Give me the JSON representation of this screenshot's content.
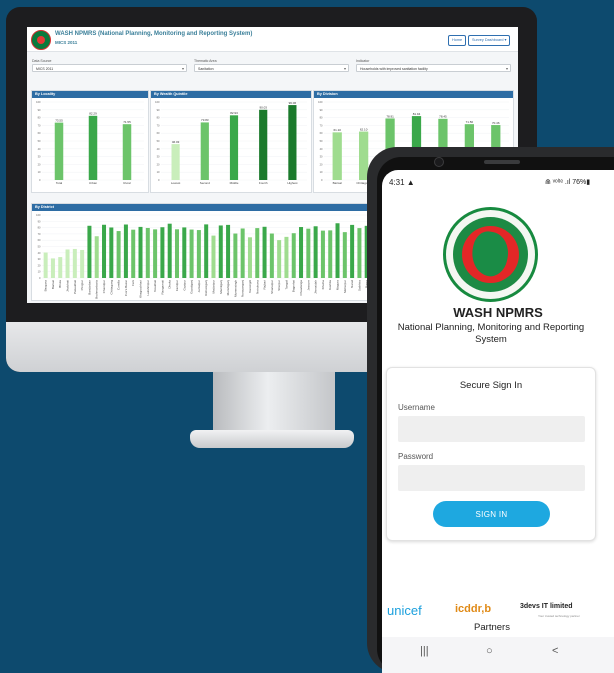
{
  "dashboard": {
    "title": "WASH NPMRS (National Planning, Monitoring and Reporting System)",
    "subtitle": "MICS 2011",
    "buttons": {
      "home": "Home",
      "survey": "Survey Dashboard ▾"
    },
    "filters": [
      {
        "label": "Data Source",
        "value": "MICS 2011"
      },
      {
        "label": "Thematic Area",
        "value": "Sanitation"
      },
      {
        "label": "Indicator",
        "value": "Households with improved sanitation facility"
      }
    ],
    "panels": {
      "locality": "By Locality",
      "wealth": "By Wealth Quintile",
      "division": "By Division",
      "district": "By District"
    }
  },
  "chart_data": [
    {
      "type": "bar",
      "title": "By Locality",
      "categories": [
        "Total",
        "Urban",
        "Rural"
      ],
      "values": [
        73.55,
        82.29,
        71.55
      ],
      "ylim": [
        0,
        100
      ]
    },
    {
      "type": "bar",
      "title": "By Wealth Quintile",
      "categories": [
        "Lowest",
        "Second",
        "Middle",
        "Fourth",
        "Highest"
      ],
      "values": [
        46.03,
        73.83,
        82.93,
        90.03,
        96.06
      ],
      "ylim": [
        0,
        100
      ]
    },
    {
      "type": "bar",
      "title": "By Division",
      "categories": [
        "Barisal",
        "Chittagong",
        "Dhaka",
        "Khulna",
        "Rajshahi",
        "Rangpur",
        "Sylhet"
      ],
      "values": [
        61.1,
        62.1,
        78.91,
        81.94,
        78.45,
        71.56,
        70.46
      ],
      "ylim": [
        0,
        100
      ]
    },
    {
      "type": "bar",
      "title": "By District",
      "categories": [
        "Barguna",
        "Barisal",
        "Bhola",
        "Jhalokati",
        "Patuakhali",
        "Pirojpur",
        "Bandarban",
        "Brahmanbaria",
        "Chandpur",
        "Chittagong",
        "Comilla",
        "Cox's Bazar",
        "Feni",
        "Khagrachhari",
        "Lakshmipur",
        "Noakhali",
        "Rangamati",
        "Dhaka",
        "Faridpur",
        "Gazipur",
        "Gopalganj",
        "Jamalpur",
        "Kishoreganj",
        "Madaripur",
        "Manikganj",
        "Munshiganj",
        "Mymensingh",
        "Narayanganj",
        "Narsingdi",
        "Netrokona",
        "Rajbari",
        "Shariatpur",
        "Sherpur",
        "Tangail",
        "Bagerhat",
        "Chuadanga",
        "Jessore",
        "Jhenaidah",
        "Khulna",
        "Kushtia",
        "Magura",
        "Meherpur",
        "Narail",
        "Satkhira",
        "Bogra",
        "Joypurhat",
        "Naogaon",
        "Natore",
        "Nawabganj",
        "Pabna",
        "Rajshahi",
        "Sirajganj",
        "Dinajpur",
        "Gaibandha",
        "Kurigram",
        "Lalmonirhat",
        "Nilphamari",
        "Panchagarh",
        "Rangpur",
        "Thakurgaon",
        "Habiganj",
        "Moulvibazar",
        "Sunamganj",
        "Sylhet"
      ],
      "values": [
        40.5,
        31.1,
        33.2,
        45.3,
        46.1,
        44.5,
        82.9,
        66.3,
        84.5,
        80.2,
        74.5,
        84.9,
        76.7,
        81.1,
        79.4,
        77.2,
        80.6,
        86.2,
        77.3,
        80.3,
        76.9,
        76.1,
        85.1,
        67.3,
        83.4,
        84.3,
        70.6,
        78.6,
        64.6,
        79.2,
        81.3,
        70.6,
        60.1,
        65.3,
        71.1,
        80.9,
        78.3,
        82.1,
        75.2,
        75.6,
        86.9,
        72.8,
        84.3,
        79.2,
        82.8,
        80.2,
        78.6,
        82.3,
        73.3,
        60.1,
        81.2,
        54.2,
        92.6,
        86.4,
        85.9,
        83.3,
        84.1,
        91.9,
        66.9,
        93.1,
        85.5,
        61.1,
        65.3,
        71.0
      ],
      "ylim": [
        0,
        100
      ]
    }
  ],
  "phone": {
    "status": {
      "time": "4:31 ▲",
      "right": "⋒ ᵛᵒˡᵗᵉ .ıl 76%▮"
    },
    "app_title": "WASH NPMRS",
    "app_subtitle": "National Planning, Monitoring and Reporting System",
    "card_title": "Secure Sign In",
    "username_label": "Username",
    "password_label": "Password",
    "signin_label": "SIGN IN",
    "partners": {
      "unicef": "unicef",
      "icddr": "icddr,b",
      "threedevs": "3devs IT limited",
      "threedevs_sub": "Your trusted technology partner",
      "label": "Partners"
    },
    "nav": {
      "recent": "|||",
      "home": "○",
      "back": "<"
    }
  }
}
